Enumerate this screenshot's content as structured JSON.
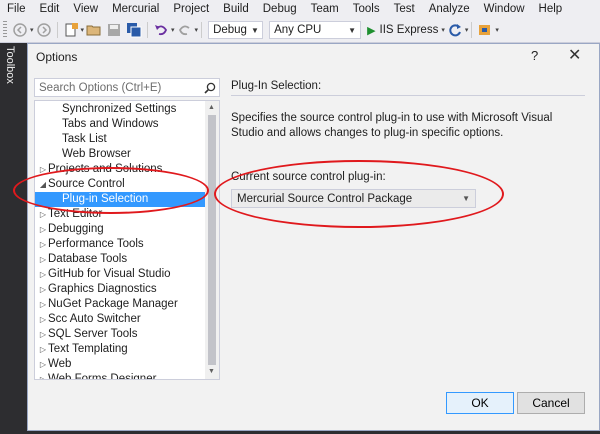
{
  "menu": [
    "File",
    "Edit",
    "View",
    "Mercurial",
    "Project",
    "Build",
    "Debug",
    "Team",
    "Tools",
    "Test",
    "Analyze",
    "Window",
    "Help"
  ],
  "toolbar": {
    "config": "Debug",
    "platform": "Any CPU",
    "run_label": "IIS Express"
  },
  "toolbox_label": "Toolbox",
  "dialog": {
    "title": "Options",
    "help": "?",
    "close": "✕",
    "search_placeholder": "Search Options (Ctrl+E)",
    "tree": [
      {
        "label": "Synchronized Settings",
        "level": 2,
        "expander": ""
      },
      {
        "label": "Tabs and Windows",
        "level": 2,
        "expander": ""
      },
      {
        "label": "Task List",
        "level": 2,
        "expander": ""
      },
      {
        "label": "Web Browser",
        "level": 2,
        "expander": ""
      },
      {
        "label": "Projects and Solutions",
        "level": 1,
        "expander": "▷"
      },
      {
        "label": "Source Control",
        "level": 1,
        "expander": "◢"
      },
      {
        "label": "Plug-in Selection",
        "level": 2,
        "expander": "",
        "selected": true
      },
      {
        "label": "Text Editor",
        "level": 1,
        "expander": "▷"
      },
      {
        "label": "Debugging",
        "level": 1,
        "expander": "▷"
      },
      {
        "label": "Performance Tools",
        "level": 1,
        "expander": "▷"
      },
      {
        "label": "Database Tools",
        "level": 1,
        "expander": "▷"
      },
      {
        "label": "GitHub for Visual Studio",
        "level": 1,
        "expander": "▷"
      },
      {
        "label": "Graphics Diagnostics",
        "level": 1,
        "expander": "▷"
      },
      {
        "label": "NuGet Package Manager",
        "level": 1,
        "expander": "▷"
      },
      {
        "label": "Scc Auto Switcher",
        "level": 1,
        "expander": "▷"
      },
      {
        "label": "SQL Server Tools",
        "level": 1,
        "expander": "▷"
      },
      {
        "label": "Text Templating",
        "level": 1,
        "expander": "▷"
      },
      {
        "label": "Web",
        "level": 1,
        "expander": "▷"
      },
      {
        "label": "Web Forms Designer",
        "level": 1,
        "expander": "▷"
      }
    ],
    "panel": {
      "title": "Plug-In Selection:",
      "description": "Specifies the source control plug-in to use with Microsoft Visual Studio and allows changes to plug-in specific options.",
      "plugin_label": "Current source control plug-in:",
      "plugin_value": "Mercurial Source Control Package"
    },
    "ok_label": "OK",
    "cancel_label": "Cancel"
  },
  "colors": {
    "selection": "#3399ff",
    "annotation": "#e0191d",
    "ide_dark": "#2d2d30"
  }
}
